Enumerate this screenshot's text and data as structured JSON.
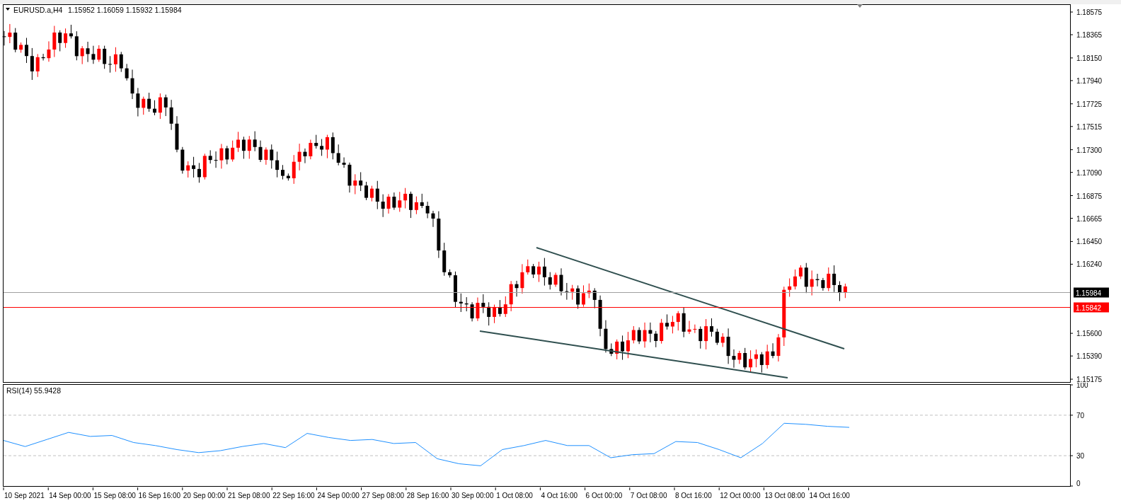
{
  "chart": {
    "symbol": "EURUSD.a,H4",
    "ohlc": [
      "1.15952",
      "1.16059",
      "1.15932",
      "1.15984"
    ],
    "price_axis": [
      "1.18575",
      "1.18365",
      "1.18150",
      "1.17940",
      "1.17725",
      "1.17515",
      "1.17300",
      "1.17090",
      "1.16875",
      "1.16665",
      "1.16450",
      "1.16240",
      "1.15600",
      "1.15390",
      "1.15175"
    ],
    "price_labels": [
      {
        "text": "1.15984",
        "kind": "bid"
      },
      {
        "text": "1.15842",
        "kind": "level"
      }
    ]
  },
  "rsi": {
    "axis": [
      "100",
      "70",
      "30",
      "0"
    ],
    "chart_data": {
      "type": "line",
      "title": "RSI(14) 55.9428",
      "ylim": [
        0,
        100
      ],
      "yticks": [
        0,
        30,
        70,
        100
      ],
      "series": [
        {
          "color": "#1e90ff",
          "values": [
            45,
            39,
            46,
            53,
            49,
            50,
            43,
            40,
            36,
            33,
            35,
            39,
            42,
            38,
            52,
            48,
            45,
            46,
            42,
            43,
            27,
            22,
            20,
            36,
            40,
            45,
            40,
            40,
            28,
            31,
            32,
            44,
            43,
            36,
            28,
            42,
            62,
            61,
            59,
            58
          ]
        }
      ]
    }
  },
  "time_axis": [
    "10 Sep 2021",
    "14 Sep 00:00",
    "15 Sep 08:00",
    "16 Sep 16:00",
    "20 Sep 00:00",
    "21 Sep 08:00",
    "22 Sep 16:00",
    "24 Sep 00:00",
    "27 Sep 08:00",
    "28 Sep 16:00",
    "30 Sep 00:00",
    "1 Oct 08:00",
    "4 Oct 16:00",
    "6 Oct 00:00",
    "7 Oct 08:00",
    "8 Oct 16:00",
    "12 Oct 00:00",
    "13 Oct 08:00",
    "14 Oct 16:00"
  ]
}
